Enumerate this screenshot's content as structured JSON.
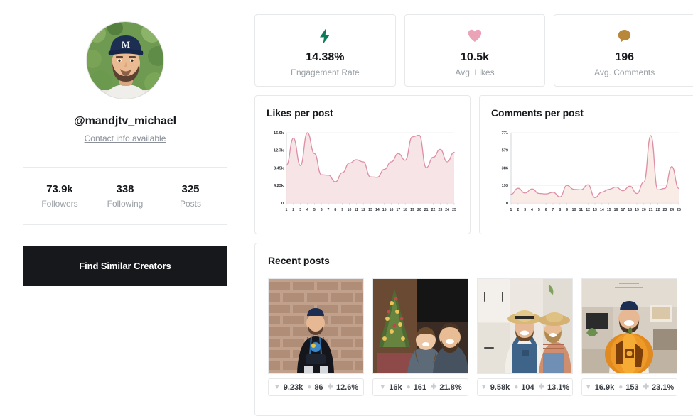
{
  "profile": {
    "avatar_icon": "user-avatar-photo",
    "avatar_alt": "Man wearing navy baseball cap with letter M, beard, greenery background",
    "handle": "@mandjtv_michael",
    "contact_link": "Contact info available",
    "stats": [
      {
        "value": "73.9k",
        "label": "Followers"
      },
      {
        "value": "338",
        "label": "Following"
      },
      {
        "value": "325",
        "label": "Posts"
      }
    ],
    "cta_label": "Find Similar Creators"
  },
  "kpis": [
    {
      "icon": "lightning-bolt-icon",
      "icon_color": "#0f7a5a",
      "value": "14.38%",
      "label": "Engagement Rate"
    },
    {
      "icon": "heart-icon",
      "icon_color": "#eba3b7",
      "value": "10.5k",
      "label": "Avg. Likes"
    },
    {
      "icon": "comment-bubble-icon",
      "icon_color": "#b8873a",
      "value": "196",
      "label": "Avg. Comments"
    }
  ],
  "charts": [
    {
      "id": "likes-per-post",
      "title": "Likes per post"
    },
    {
      "id": "comments-per-post",
      "title": "Comments per post"
    }
  ],
  "chart_data": [
    {
      "type": "area",
      "id": "likes-per-post",
      "title": "Likes per post",
      "xlabel": "",
      "ylabel": "",
      "grid": true,
      "legend": "none",
      "line_color": "#dd8fa6",
      "fill_color": "#f6dfe2",
      "x": [
        1,
        2,
        3,
        4,
        5,
        6,
        7,
        8,
        9,
        10,
        11,
        12,
        13,
        14,
        15,
        16,
        17,
        18,
        19,
        20,
        21,
        22,
        23,
        24,
        25
      ],
      "categories": [
        "1",
        "2",
        "3",
        "4",
        "5",
        "6",
        "7",
        "8",
        "9",
        "10",
        "11",
        "12",
        "13",
        "14",
        "15",
        "16",
        "17",
        "18",
        "19",
        "20",
        "21",
        "22",
        "23",
        "24",
        "25"
      ],
      "values": [
        9100,
        15600,
        9000,
        16900,
        11900,
        6800,
        6700,
        5100,
        7300,
        9600,
        10400,
        9900,
        6300,
        6200,
        8100,
        9900,
        11900,
        10300,
        15900,
        16300,
        8500,
        11000,
        12900,
        9900,
        12200
      ],
      "ylim": [
        0,
        16900
      ],
      "yticks": [
        0,
        4230,
        8450,
        12700,
        16900
      ],
      "ytick_labels": [
        "0",
        "4.23k",
        "8.45k",
        "12.7k",
        "16.9k"
      ],
      "xtick_labels": [
        "1",
        "2",
        "3",
        "4",
        "5",
        "6",
        "7",
        "8",
        "9",
        "10",
        "11",
        "12",
        "13",
        "14",
        "15",
        "16",
        "17",
        "18",
        "19",
        "20",
        "21",
        "22",
        "23",
        "24",
        "25"
      ]
    },
    {
      "type": "area",
      "id": "comments-per-post",
      "title": "Comments per post",
      "xlabel": "",
      "ylabel": "",
      "grid": true,
      "legend": "none",
      "line_color": "#dd8fa6",
      "fill_color": "#f8e7e2",
      "x": [
        1,
        2,
        3,
        4,
        5,
        6,
        7,
        8,
        9,
        10,
        11,
        12,
        13,
        14,
        15,
        16,
        17,
        18,
        19,
        20,
        21,
        22,
        23,
        24,
        25
      ],
      "categories": [
        "1",
        "2",
        "3",
        "4",
        "5",
        "6",
        "7",
        "8",
        "9",
        "10",
        "11",
        "12",
        "13",
        "14",
        "15",
        "16",
        "17",
        "18",
        "19",
        "20",
        "21",
        "22",
        "23",
        "24",
        "25"
      ],
      "values": [
        96,
        162,
        110,
        155,
        105,
        100,
        118,
        68,
        193,
        150,
        145,
        200,
        60,
        120,
        150,
        175,
        135,
        185,
        105,
        230,
        740,
        145,
        160,
        400,
        160
      ],
      "ylim": [
        0,
        771
      ],
      "yticks": [
        0,
        193,
        386,
        579,
        771
      ],
      "ytick_labels": [
        "0",
        "193",
        "386",
        "579",
        "771"
      ],
      "xtick_labels": [
        "1",
        "2",
        "3",
        "4",
        "5",
        "6",
        "7",
        "8",
        "9",
        "10",
        "11",
        "12",
        "13",
        "14",
        "15",
        "16",
        "17",
        "18",
        "19",
        "20",
        "21",
        "22",
        "23",
        "24",
        "25"
      ]
    }
  ],
  "recent_posts": {
    "title": "Recent posts",
    "items": [
      {
        "thumb_alt": "Man in black hoodie standing against brick wall",
        "likes": "9.23k",
        "comments": "86",
        "engagement": "12.6%"
      },
      {
        "thumb_alt": "Couple in matching pajamas in front of Christmas tree",
        "likes": "16k",
        "comments": "161",
        "engagement": "21.8%"
      },
      {
        "thumb_alt": "Couple in straw hats and overalls in a kitchen",
        "likes": "9.58k",
        "comments": "104",
        "engagement": "13.1%"
      },
      {
        "thumb_alt": "Man holding carved jack-o-lantern pumpkin",
        "likes": "16.9k",
        "comments": "153",
        "engagement": "23.1%"
      }
    ],
    "icons": {
      "likes": "heart-icon",
      "comments": "comment-icon",
      "engagement": "engagement-icon"
    }
  }
}
